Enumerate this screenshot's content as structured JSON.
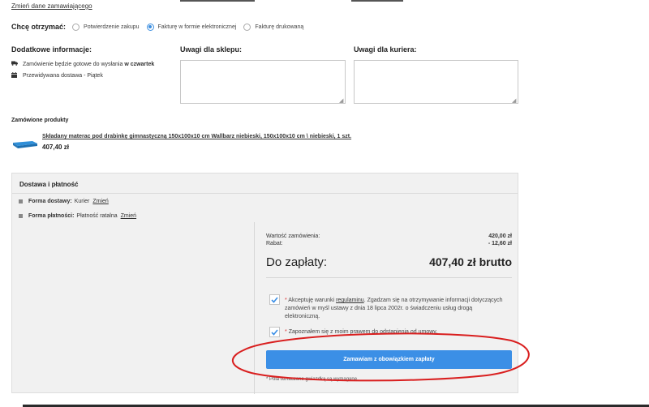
{
  "header": {
    "change_data_link": "Zmień dane zamawiającego"
  },
  "receive": {
    "label": "Chcę otrzymać:",
    "options": [
      {
        "label": "Potwierdzenie zakupu",
        "checked": false
      },
      {
        "label": "Fakturę w formie elektronicznej",
        "checked": true
      },
      {
        "label": "Fakturę drukowaną",
        "checked": false
      }
    ]
  },
  "additional_info": {
    "title": "Dodatkowe informacje:",
    "ready_text": "Zamówienie będzie gotowe do wysłania",
    "ready_day": "w czwartek",
    "delivery_text": "Przewidywana dostawa - Piątek",
    "ready_icon": "truck-icon",
    "delivery_icon": "calendar-icon"
  },
  "notes": {
    "shop_label": "Uwagi dla sklepu:",
    "courier_label": "Uwagi dla kuriera:",
    "shop_value": "",
    "courier_value": ""
  },
  "ordered": {
    "title": "Zamówione produkty",
    "product_name": "Składany materac pod drabinkę gimnastyczną 150x100x10 cm Wallbarz niebieski, 150x100x10 cm \\ niebieski, 1 szt.",
    "product_price": "407,40 zł"
  },
  "summary": {
    "title": "Dostawa i płatność",
    "delivery_label": "Forma dostawy:",
    "delivery_value": "Kurier",
    "payment_label": "Forma płatności:",
    "payment_value": "Płatność ratalna",
    "change_label": "Zmień",
    "order_value_label": "Wartość zamówienia:",
    "order_value": "420,00 zł",
    "discount_label": "Rabat:",
    "discount_value": "- 12,60 zł",
    "to_pay_label": "Do zapłaty:",
    "to_pay_value": "407,40 zł brutto"
  },
  "consents": {
    "terms_star": "*",
    "terms_pre": "Akceptuję warunki",
    "terms_link": "regulaminu",
    "terms_post": ". Zgadzam się na otrzymywanie informacji dotyczących zamówień w myśl ustawy z dnia 18 lipca 2002r. o świadczeniu usług drogą elektroniczną.",
    "withdraw_star": "*",
    "withdraw_text": "Zapoznałem się z moim prawem do odstąpienia od umowy.",
    "terms_checked": true,
    "withdraw_checked": true
  },
  "submit_label": "Zamawiam z obowiązkiem zapłaty",
  "footnote": "* Pola oznaczone gwiazdką są wymagane.",
  "colors": {
    "accent": "#3b8fe6",
    "annotation": "#d91f1f",
    "panel_bg": "#f1f1f1"
  }
}
